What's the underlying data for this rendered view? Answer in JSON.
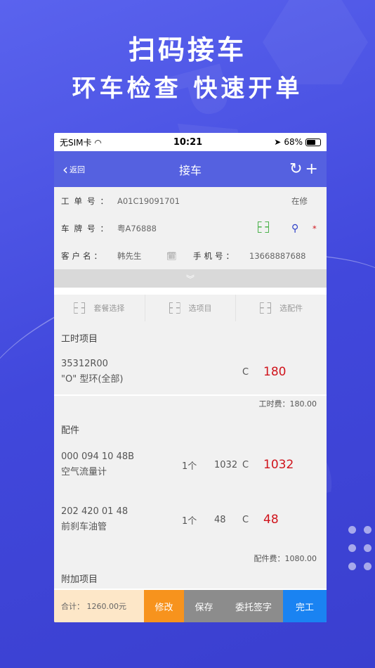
{
  "promo": {
    "headline": "扫码接车",
    "subline": "环车检查 快速开单",
    "bg_text": "PALMMSG"
  },
  "statusbar": {
    "carrier": "无SIM卡",
    "time": "10:21",
    "battery": "68%"
  },
  "navbar": {
    "back_label": "返回",
    "title": "接车",
    "refresh_icon": "↻",
    "add_icon": "+"
  },
  "info": {
    "order_label": "工单号：",
    "order_value": "A01C19091701",
    "order_status": "在修",
    "plate_label": "车牌号：",
    "plate_value": "粤A76888",
    "required_mark": "*",
    "customer_label": "客户名：",
    "customer_value": "韩先生",
    "phone_label": "手机号：",
    "phone_value": "13668887688"
  },
  "expand_icon": "︾",
  "selectors": [
    {
      "label": "套餐选择"
    },
    {
      "label": "选项目"
    },
    {
      "label": "选配件"
    }
  ],
  "labor": {
    "title": "工时项目",
    "items": [
      {
        "code": "35312R00",
        "name": "\"O\" 型环(全部)",
        "level": "C",
        "total": "180"
      }
    ],
    "fee_label": "工时费：",
    "fee_value": "180.00"
  },
  "parts": {
    "title": "配件",
    "items": [
      {
        "code": "000 094 10 48B",
        "name": "空气流量计",
        "qty": "1个",
        "price": "1032",
        "level": "C",
        "total": "1032"
      },
      {
        "code": "202 420 01 48",
        "name": "前刹车油管",
        "qty": "1个",
        "price": "48",
        "level": "C",
        "total": "48"
      }
    ],
    "fee_label": "配件费：",
    "fee_value": "1080.00"
  },
  "extra": {
    "title": "附加项目"
  },
  "bottom": {
    "sum_label": "合计：",
    "sum_value": "1260.00元",
    "edit": "修改",
    "save": "保存",
    "sign": "委托签字",
    "done": "完工"
  },
  "colors": {
    "background": "#4148dc",
    "navbar": "#5561e0",
    "total_red": "#d0141c",
    "edit_orange": "#f7931d",
    "done_blue": "#1a83f2"
  }
}
